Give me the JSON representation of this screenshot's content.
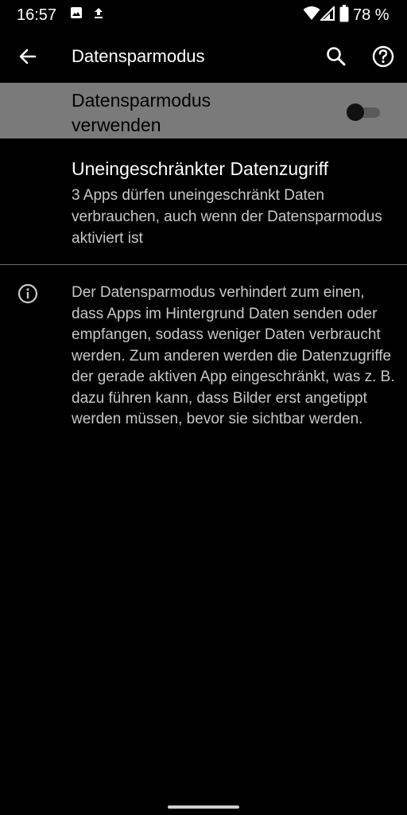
{
  "status_bar": {
    "time": "16:57",
    "battery_percent": "78 %",
    "icons": [
      "image-icon",
      "upload-icon",
      "wifi-icon",
      "signal-icon",
      "battery-icon"
    ]
  },
  "app_bar": {
    "title": "Datensparmodus",
    "icons": [
      "back-arrow-icon",
      "search-icon",
      "help-icon"
    ]
  },
  "main_toggle": {
    "label": "Datensparmodus verwenden",
    "enabled": false
  },
  "unrestricted_data": {
    "title": "Uneingeschränkter Datenzugriff",
    "summary": "3 Apps dürfen uneingeschränkt Daten verbrauchen, auch wenn der Datensparmodus aktiviert ist"
  },
  "info": {
    "icon": "info-icon",
    "text": "Der Datensparmodus verhindert zum einen, dass Apps im Hintergrund Daten senden oder empfangen, sodass weniger Daten verbraucht werden. Zum anderen werden die Datenzugriffe der gerade aktiven App eingeschränkt, was z. B. dazu führen kann, dass Bilder erst angetippt werden müssen, bevor sie sichtbar werden."
  },
  "colors": {
    "background": "#000000",
    "highlight_row": "#7a7a7a",
    "secondary_text": "#c8c8c8",
    "divider": "#6a6a6a"
  }
}
